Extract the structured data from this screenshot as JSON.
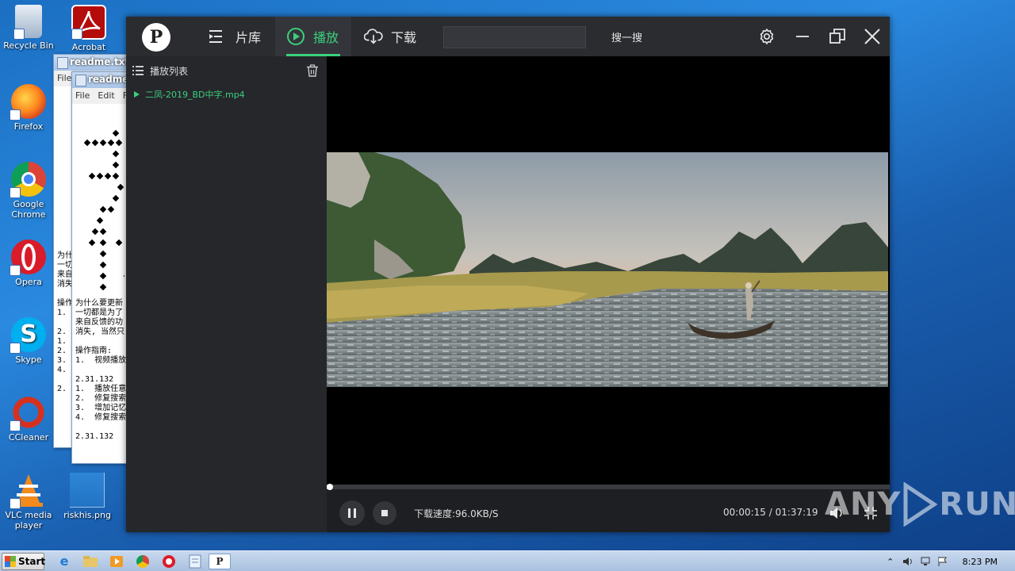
{
  "desktop": {
    "icons": [
      {
        "label": "Recycle Bin",
        "icon": "recycle-bin-icon"
      },
      {
        "label": "Acrobat",
        "icon": "acrobat-icon"
      },
      {
        "label": "Firefox",
        "icon": "firefox-icon"
      },
      {
        "label": "Google Chrome",
        "icon": "chrome-icon"
      },
      {
        "label": "Opera",
        "icon": "opera-icon"
      },
      {
        "label": "Skype",
        "icon": "skype-icon"
      },
      {
        "label": "CCleaner",
        "icon": "ccleaner-icon"
      },
      {
        "label": "VLC media player",
        "icon": "vlc-icon"
      },
      {
        "label": "riskhis.png",
        "icon": "image-file-icon"
      }
    ]
  },
  "notepad_back": {
    "title": "readme.txt -",
    "menu": [
      "File"
    ],
    "body": "\n\n\n\n\n\n\n\n\n\n\n\n\n\n\n\n\n为什\n一切\n来自\n消失\n\n操作\n1.\n\n2.\n1.\n2.\n3.\n4.\n\n2."
  },
  "notepad_front": {
    "title": "readme.",
    "menu": [
      "File",
      "Edit",
      "F"
    ],
    "body_lines": [
      "",
      "",
      "",
      "",
      "",
      "",
      "",
      "",
      "",
      "",
      "",
      "",
      "",
      "",
      "",
      "",
      "",
      "",
      "",
      "",
      "为什么要更新",
      "一切都是为了",
      "来自反馈的功",
      "消失, 当然只",
      "",
      "操作指南:",
      "1.  视频播放",
      "",
      "2.31.132",
      "1.  播放任意",
      "2.  修复搜索",
      "3.  增加记忆",
      "4.  修复搜索",
      "",
      "2.31.132"
    ]
  },
  "player": {
    "logo": "P",
    "nav": [
      {
        "label": "片库",
        "icon": "library-icon"
      },
      {
        "label": "播放",
        "icon": "play-circle-icon",
        "active": true
      },
      {
        "label": "下载",
        "icon": "cloud-download-icon"
      }
    ],
    "search": {
      "value": "",
      "button": "搜一搜"
    },
    "window_controls": [
      "settings-icon",
      "minimize-icon",
      "restore-icon",
      "close-icon"
    ],
    "playlist": {
      "title": "播放列表",
      "items": [
        "二凤-2019_BD中字.mp4"
      ]
    },
    "playback": {
      "download_speed": "下载速度:96.0KB/S",
      "current_time": "00:00:15",
      "separator": " / ",
      "total_time": "01:37:19",
      "progress_fraction": 0.0026
    }
  },
  "watermark": {
    "text_left": "ANY",
    "text_right": "RUN"
  },
  "taskbar": {
    "start_label": "Start",
    "clock": "8:23 PM"
  },
  "colors": {
    "accent": "#3ad07f",
    "player_bg": "#1e1f22",
    "desktop": "#1b6fc2"
  }
}
